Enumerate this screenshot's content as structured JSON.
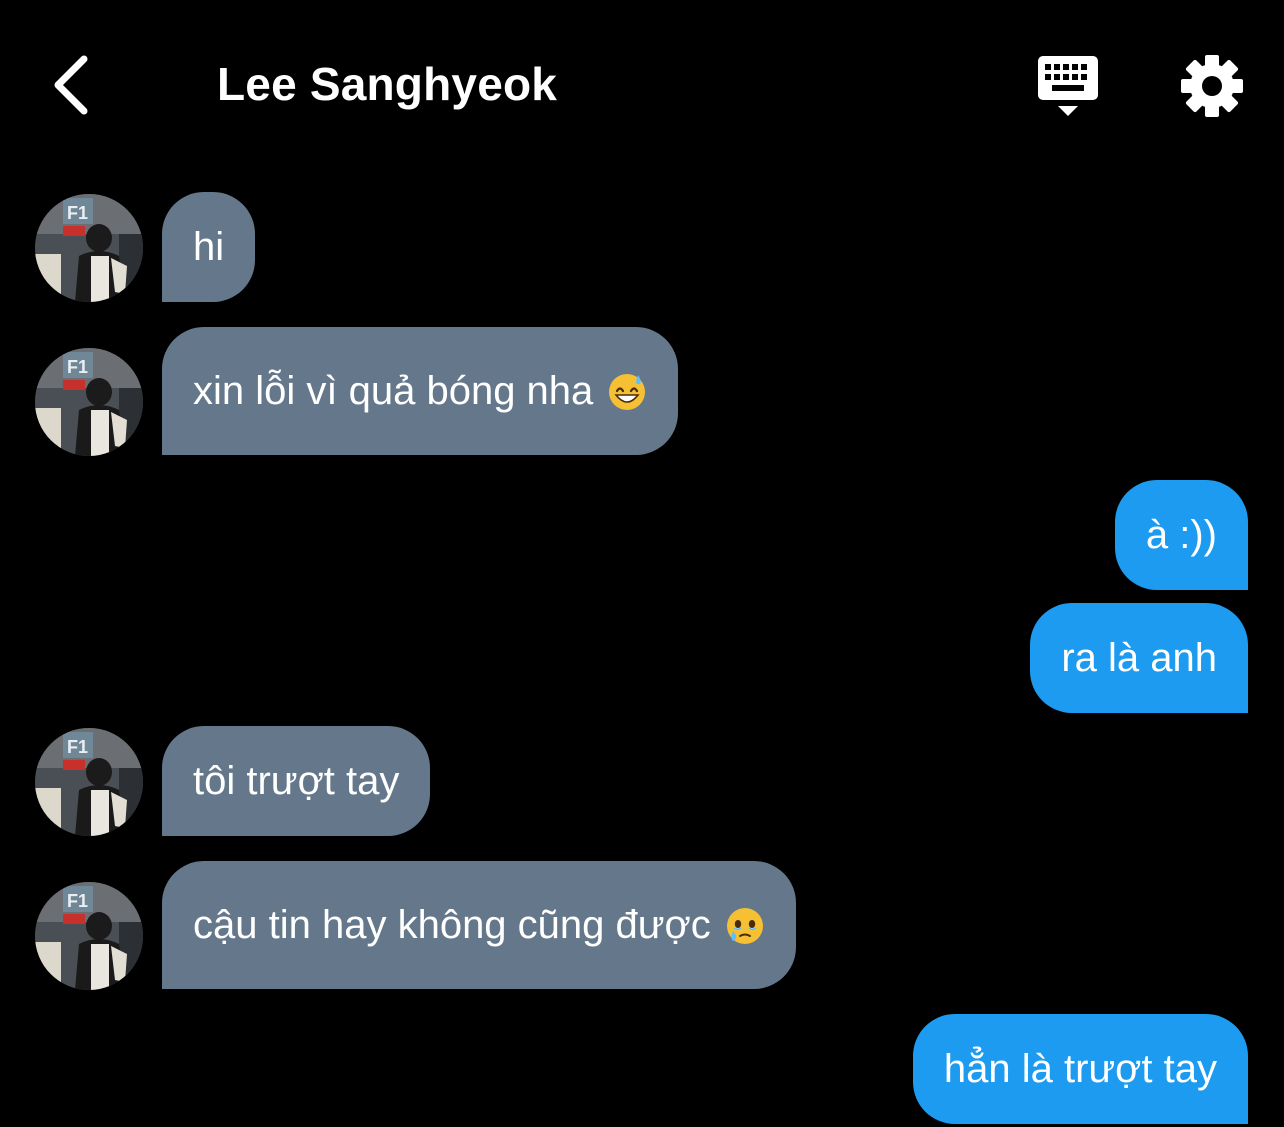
{
  "header": {
    "title": "Lee Sanghyeok",
    "back_icon": "chevron-left-icon",
    "keyboard_icon": "keyboard-icon",
    "settings_icon": "gear-icon"
  },
  "avatar": {
    "icon": "avatar-photo",
    "badge_text": "F1"
  },
  "colors": {
    "background": "#000000",
    "incoming_bubble": "#65778a",
    "outgoing_bubble": "#1d9bf0",
    "text": "#ffffff"
  },
  "messages": [
    {
      "direction": "in",
      "text": "hi",
      "emoji": ""
    },
    {
      "direction": "in",
      "text": "xin lỗi vì quả bóng nha",
      "emoji": "grinning-sweat-emoji"
    },
    {
      "direction": "out",
      "text": "à :))",
      "emoji": ""
    },
    {
      "direction": "out",
      "text": "ra là anh",
      "emoji": ""
    },
    {
      "direction": "in",
      "text": "tôi trượt tay",
      "emoji": ""
    },
    {
      "direction": "in",
      "text": "cậu tin hay không cũng được",
      "emoji": "holding-back-tears-emoji"
    },
    {
      "direction": "out",
      "text": "hẳn là trượt tay",
      "emoji": ""
    }
  ]
}
